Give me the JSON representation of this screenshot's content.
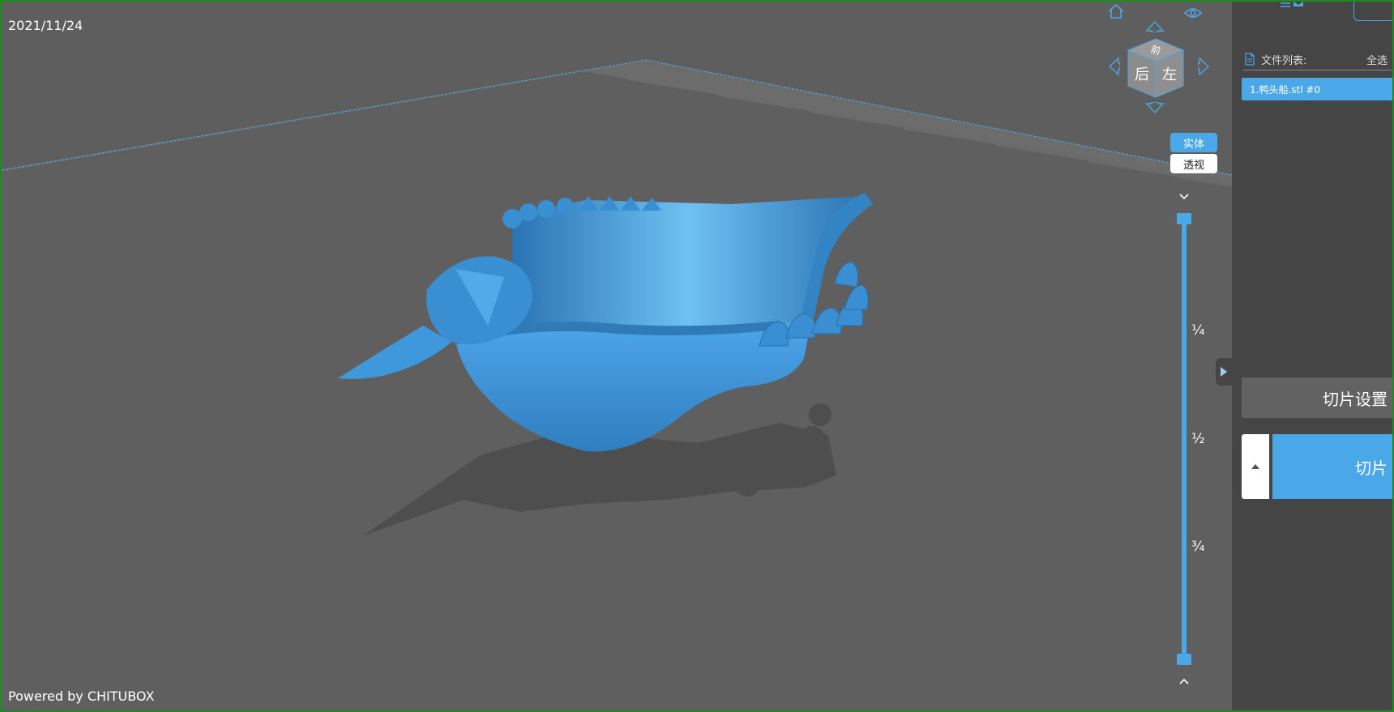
{
  "viewport": {
    "date": "2021/11/24",
    "powered_by": "Powered by CHITUBOX",
    "model_color": "#3a8fd3",
    "accent_color": "#4aa7e8"
  },
  "navcube": {
    "face_top": "前",
    "face_left": "后",
    "face_right": "左",
    "icons": [
      "home-icon",
      "eye-icon",
      "arrow-up-icon",
      "arrow-down-icon",
      "arrow-left-icon",
      "arrow-right-icon"
    ]
  },
  "render_modes": {
    "solid": "实体",
    "perspective": "透视"
  },
  "layer_slider": {
    "quarter": "¼",
    "half": "½",
    "three_quarter": "¾",
    "top_value": 1.0,
    "bottom_value": 0.0
  },
  "side_panel": {
    "file_list_label": "文件列表:",
    "select_all": "全选",
    "files": [
      {
        "name": "1.鸭头船.stl #0",
        "selected": true
      }
    ],
    "slice_settings": "切片设置",
    "slice": "切片"
  }
}
